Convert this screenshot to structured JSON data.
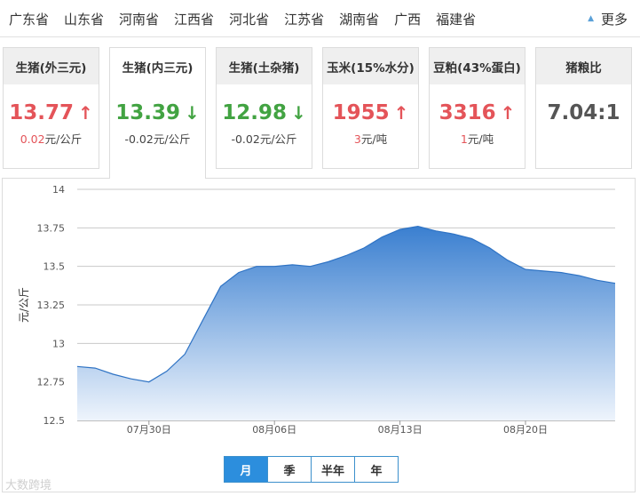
{
  "provinces": [
    "广东省",
    "山东省",
    "河南省",
    "江西省",
    "河北省",
    "江苏省",
    "湖南省",
    "广西",
    "福建省"
  ],
  "more_label": "更多",
  "more_icon": "triangle-up-icon",
  "cards": [
    {
      "title": "生猪(外三元)",
      "price": "13.77",
      "trend": "up",
      "change_value": "0.02",
      "change_unit": "元/公斤"
    },
    {
      "title": "生猪(内三元)",
      "price": "13.39",
      "trend": "down",
      "change_value": "-0.02",
      "change_unit": "元/公斤"
    },
    {
      "title": "生猪(土杂猪)",
      "price": "12.98",
      "trend": "down",
      "change_value": "-0.02",
      "change_unit": "元/公斤"
    },
    {
      "title": "玉米(15%水分)",
      "price": "1955",
      "trend": "up",
      "change_value": "3",
      "change_unit": "元/吨"
    },
    {
      "title": "豆粕(43%蛋白)",
      "price": "3316",
      "trend": "up",
      "change_value": "1",
      "change_unit": "元/吨"
    },
    {
      "title": "猪粮比",
      "price": "7.04:1",
      "trend": "none",
      "change_value": "",
      "change_unit": ""
    }
  ],
  "active_card": 1,
  "colors": {
    "up": "#e45459",
    "down": "#42a342",
    "accent": "#2c8edd",
    "area_top": "#3a7fd0",
    "area_bottom": "#eef4fc",
    "grid": "#c8c8c8"
  },
  "range_buttons": [
    "月",
    "季",
    "半年",
    "年"
  ],
  "active_range": 0,
  "watermark": "大数跨境",
  "chart_data": {
    "type": "area",
    "ylabel": "元/公斤",
    "ylim": [
      12.5,
      14
    ],
    "yticks": [
      "12.5",
      "12.75",
      "13",
      "13.25",
      "13.5",
      "13.75",
      "14"
    ],
    "xticks": [
      {
        "label": "07月30日",
        "index": 4
      },
      {
        "label": "08月06日",
        "index": 11
      },
      {
        "label": "08月13日",
        "index": 18
      },
      {
        "label": "08月20日",
        "index": 25
      }
    ],
    "values": [
      12.85,
      12.84,
      12.8,
      12.77,
      12.75,
      12.82,
      12.93,
      13.15,
      13.37,
      13.46,
      13.5,
      13.5,
      13.51,
      13.5,
      13.53,
      13.57,
      13.62,
      13.69,
      13.74,
      13.76,
      13.73,
      13.71,
      13.68,
      13.62,
      13.54,
      13.48,
      13.47,
      13.46,
      13.44,
      13.41,
      13.39
    ],
    "grid": true,
    "legend": "none"
  }
}
